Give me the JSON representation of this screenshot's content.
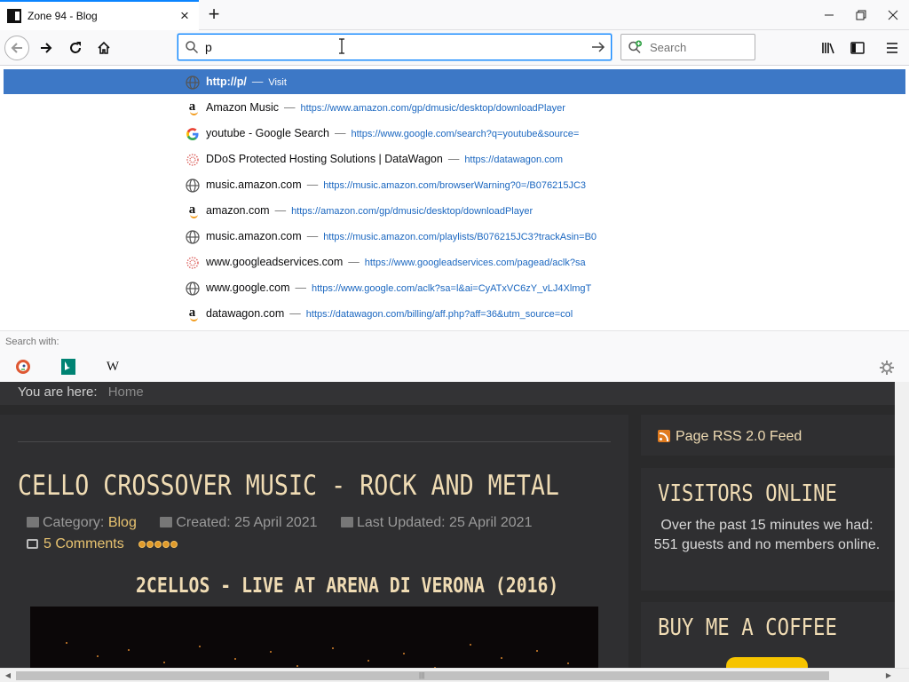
{
  "browser": {
    "tab": {
      "title": "Zone 94 - Blog",
      "close": "×"
    },
    "new_tab": "+",
    "window": {
      "minimize": "—",
      "maximize": "❐",
      "close": "✕"
    },
    "urlbar": {
      "value": "p"
    },
    "searchbar": {
      "placeholder": "Search"
    }
  },
  "autocomplete": {
    "rows": [
      {
        "title": "http://p/",
        "separator": "—",
        "url": "Visit",
        "icon": "globe-icon"
      },
      {
        "title": "Amazon Music",
        "separator": "—",
        "url": "https://www.amazon.com/gp/dmusic/desktop/downloadPlayer",
        "icon": "amazon-icon"
      },
      {
        "title": "youtube - Google Search",
        "separator": "—",
        "url": "https://www.google.com/search?q=youtube&source=",
        "icon": "google-icon"
      },
      {
        "title": "DDoS Protected Hosting Solutions | DataWagon",
        "separator": "—",
        "url": "https://datawagon.com",
        "icon": "datawagon-icon"
      },
      {
        "title": "music.amazon.com",
        "separator": "—",
        "url": "https://music.amazon.com/browserWarning?0=/B076215JC3",
        "icon": "globe-icon"
      },
      {
        "title": "amazon.com",
        "separator": "—",
        "url": "https://amazon.com/gp/dmusic/desktop/downloadPlayer",
        "icon": "amazon-icon"
      },
      {
        "title": "music.amazon.com",
        "separator": "—",
        "url": "https://music.amazon.com/playlists/B076215JC3?trackAsin=B0",
        "icon": "globe-icon"
      },
      {
        "title": "www.googleadservices.com",
        "separator": "—",
        "url": "https://www.googleadservices.com/pagead/aclk?sa",
        "icon": "datawagon-icon"
      },
      {
        "title": "www.google.com",
        "separator": "—",
        "url": "https://www.google.com/aclk?sa=l&ai=CyATxVC6zY_vLJ4XlmgT",
        "icon": "globe-icon"
      },
      {
        "title": "datawagon.com",
        "separator": "—",
        "url": "https://datawagon.com/billing/aff.php?aff=36&utm_source=col",
        "icon": "amazon-icon"
      }
    ],
    "search_with": "Search with:",
    "engines": [
      "duckduckgo-icon",
      "bing-icon",
      "wikipedia-icon"
    ],
    "wikipedia_letter": "W"
  },
  "site": {
    "breadcrumb": {
      "label": "You are here:",
      "home": "Home"
    },
    "article": {
      "title": "CELLO CROSSOVER MUSIC - ROCK AND METAL",
      "category_label": "Category:",
      "category": "Blog",
      "created": "Created: 25 April 2021",
      "updated": "Last Updated: 25 April 2021",
      "comments": "5 Comments",
      "rating": 5,
      "video_title": "2CELLOS - LIVE AT ARENA DI VERONA (2016)"
    },
    "sidebar": {
      "rss": "Page RSS 2.0 Feed",
      "visitors_heading": "VISITORS ONLINE",
      "visitors_text": "Over the past 15 minutes we had: 551 guests and no members online.",
      "coffee_heading": "BUY ME A COFFEE"
    }
  },
  "colors": {
    "accent": "#0a84ff",
    "selected_row": "#3d78c6",
    "site_heading": "#f0dcb4",
    "site_link": "#e8c370"
  }
}
